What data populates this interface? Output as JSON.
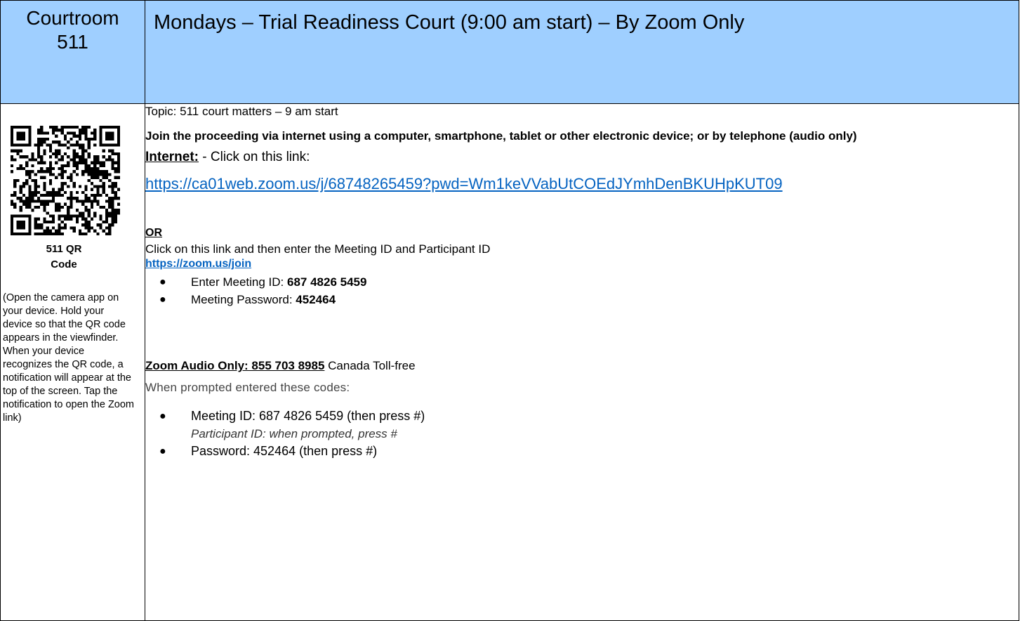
{
  "header": {
    "courtroom_line1": "Courtroom",
    "courtroom_line2": "511",
    "title": "Mondays – Trial Readiness Court (9:00 am start) – By Zoom Only",
    "background_color": "#9fcfff"
  },
  "left": {
    "qr_icon": "qr-code-icon",
    "qr_caption_line1": "511 QR",
    "qr_caption_line2": "Code",
    "instructions": "(Open the camera app on your device. Hold your device so that the QR code appears in the viewfinder. When your device recognizes the QR code, a notification will appear at the top of the screen. Tap the notification to open the Zoom link)"
  },
  "main": {
    "topic": "Topic: 511 court matters – 9 am start",
    "join_text": "Join the proceeding via internet using a computer, smartphone, tablet or other electronic device; or by telephone (audio only)",
    "internet_label": "Internet:",
    "internet_text": " - Click on this link:",
    "zoom_link": "https://ca01web.zoom.us/j/68748265459?pwd=Wm1keVVabUtCOEdJYmhDenBKUHpKUT09",
    "or_label": "OR",
    "click_text": "Click on this link and then enter the Meeting ID and Participant ID",
    "join_link": "https://zoom.us/join",
    "bullets": [
      {
        "label": "Enter Meeting ID: ",
        "value": "687 4826 5459"
      },
      {
        "label": "Meeting Password: ",
        "value": "452464"
      }
    ],
    "audio_label": "Zoom Audio Only:  855 703 8985",
    "audio_text": " Canada Toll-free",
    "prompted_text": "When prompted entered these codes:",
    "code_meeting": "Meeting ID: 687 4826 5459 (then press #)",
    "code_participant": "Participant ID: when prompted, press #",
    "code_password": "Password: 452464 (then press #)",
    "link_color": "#0563c1"
  }
}
